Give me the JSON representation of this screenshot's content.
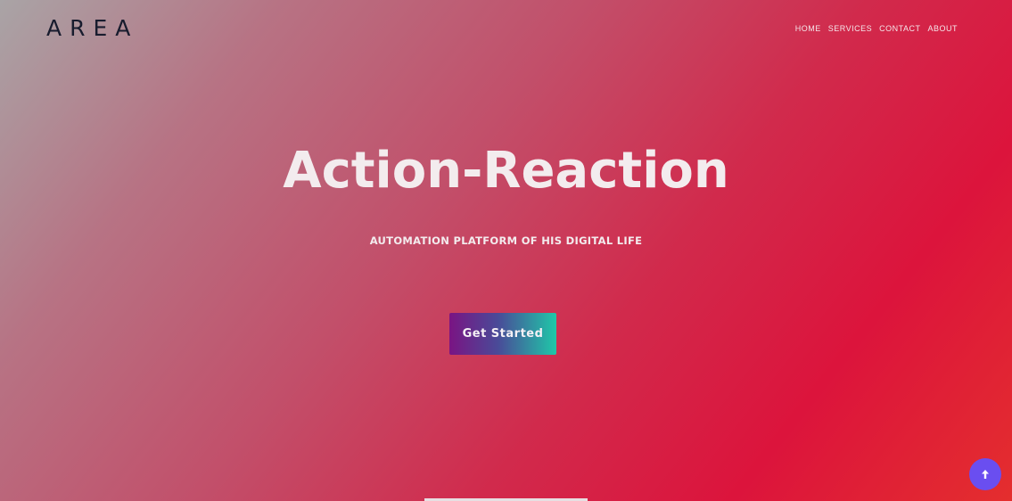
{
  "header": {
    "logo_text": "AREA",
    "nav": [
      "HOME",
      "SERVICES",
      "CONTACT",
      "ABOUT"
    ]
  },
  "hero": {
    "title": "Action-Reaction",
    "subtitle": "AUTOMATION PLATFORM OF HIS DIGITAL LIFE",
    "cta_label": "Get Started"
  },
  "floating": {
    "scroll_top_icon": "arrow-up-icon"
  },
  "colors": {
    "accent_gradient_start": "#7a1483",
    "accent_gradient_end": "#1fc8a8",
    "scroll_button": "#6a4ef0",
    "background_end": "#dc143c"
  }
}
